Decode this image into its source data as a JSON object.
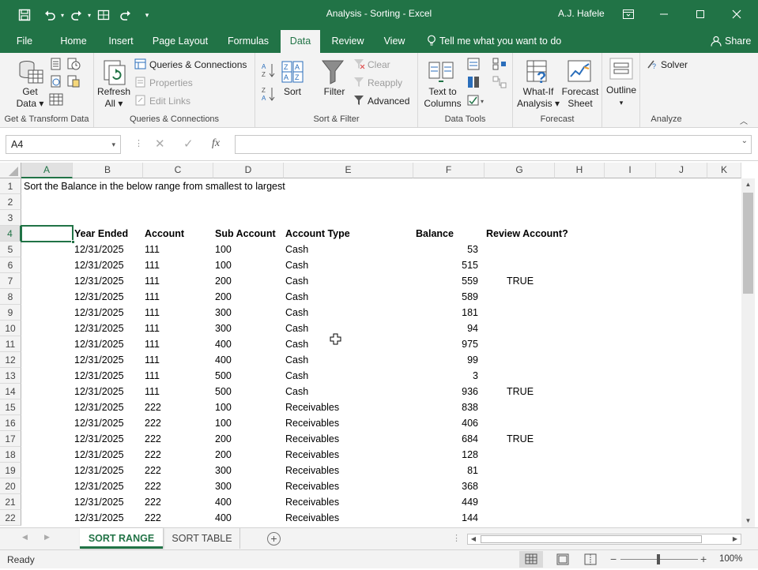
{
  "window": {
    "title": "Analysis - Sorting  -  Excel",
    "user": "A.J. Hafele",
    "accent": "#217346"
  },
  "quick_access": {
    "icons": [
      "save-icon",
      "undo-icon",
      "redo-icon",
      "form-icon",
      "repeat-icon",
      "customize-icon"
    ]
  },
  "menu_tabs": [
    "File",
    "Home",
    "Insert",
    "Page Layout",
    "Formulas",
    "Data",
    "Review",
    "View"
  ],
  "active_tab": "Data",
  "tell_me": "Tell me what you want to do",
  "share": "Share",
  "ribbon": {
    "get_transform": {
      "label": "Get & Transform Data",
      "get_data_1": "Get",
      "get_data_2": "Data"
    },
    "queries": {
      "label": "Queries & Connections",
      "refresh_1": "Refresh",
      "refresh_2": "All",
      "queries_connections": "Queries & Connections",
      "properties": "Properties",
      "edit_links": "Edit Links"
    },
    "sort_filter": {
      "label": "Sort & Filter",
      "sort": "Sort",
      "filter": "Filter",
      "clear": "Clear",
      "reapply": "Reapply",
      "advanced": "Advanced"
    },
    "data_tools": {
      "label": "Data Tools",
      "text_to_1": "Text to",
      "text_to_2": "Columns"
    },
    "forecast": {
      "label": "Forecast",
      "whatif_1": "What-If",
      "whatif_2": "Analysis",
      "forecast_1": "Forecast",
      "forecast_2": "Sheet"
    },
    "outline": {
      "label": "Outline"
    },
    "analyze": {
      "label": "Analyze",
      "solver": "Solver"
    }
  },
  "name_box": "A4",
  "formula": "",
  "fx": "fx",
  "columns": [
    "A",
    "B",
    "C",
    "D",
    "E",
    "F",
    "G",
    "H",
    "I",
    "J",
    "K"
  ],
  "row_numbers": [
    "1",
    "2",
    "3",
    "4",
    "5",
    "6",
    "7",
    "8",
    "9",
    "10",
    "11",
    "12",
    "13",
    "14",
    "15",
    "16",
    "17",
    "18",
    "19",
    "20",
    "21",
    "22"
  ],
  "instruction": "Sort the Balance in the below range from smallest to largest",
  "headers": [
    "Year Ended",
    "Account",
    "Sub Account",
    "Account Type",
    "Balance",
    "Review Account?"
  ],
  "rows": [
    [
      "12/31/2025",
      "111",
      "100",
      "Cash",
      "53",
      ""
    ],
    [
      "12/31/2025",
      "111",
      "100",
      "Cash",
      "515",
      ""
    ],
    [
      "12/31/2025",
      "111",
      "200",
      "Cash",
      "559",
      "TRUE"
    ],
    [
      "12/31/2025",
      "111",
      "200",
      "Cash",
      "589",
      ""
    ],
    [
      "12/31/2025",
      "111",
      "300",
      "Cash",
      "181",
      ""
    ],
    [
      "12/31/2025",
      "111",
      "300",
      "Cash",
      "94",
      ""
    ],
    [
      "12/31/2025",
      "111",
      "400",
      "Cash",
      "975",
      ""
    ],
    [
      "12/31/2025",
      "111",
      "400",
      "Cash",
      "99",
      ""
    ],
    [
      "12/31/2025",
      "111",
      "500",
      "Cash",
      "3",
      ""
    ],
    [
      "12/31/2025",
      "111",
      "500",
      "Cash",
      "936",
      "TRUE"
    ],
    [
      "12/31/2025",
      "222",
      "100",
      "Receivables",
      "838",
      ""
    ],
    [
      "12/31/2025",
      "222",
      "100",
      "Receivables",
      "406",
      ""
    ],
    [
      "12/31/2025",
      "222",
      "200",
      "Receivables",
      "684",
      "TRUE"
    ],
    [
      "12/31/2025",
      "222",
      "200",
      "Receivables",
      "128",
      ""
    ],
    [
      "12/31/2025",
      "222",
      "300",
      "Receivables",
      "81",
      ""
    ],
    [
      "12/31/2025",
      "222",
      "300",
      "Receivables",
      "368",
      ""
    ],
    [
      "12/31/2025",
      "222",
      "400",
      "Receivables",
      "449",
      ""
    ],
    [
      "12/31/2025",
      "222",
      "400",
      "Receivables",
      "144",
      ""
    ]
  ],
  "sheets": [
    "SORT RANGE",
    "SORT TABLE"
  ],
  "active_sheet": "SORT RANGE",
  "status": "Ready",
  "zoom": "100%"
}
